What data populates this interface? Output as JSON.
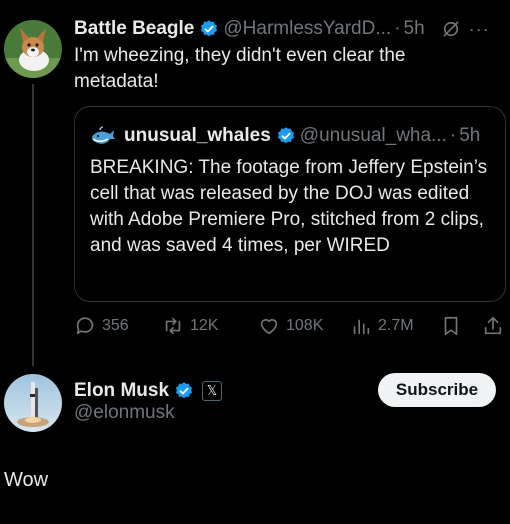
{
  "tweet": {
    "author_name": "Battle Beagle",
    "author_handle": "@HarmlessYardD...",
    "separator": "·",
    "time": "5h",
    "more_label": "···",
    "text": "I'm wheezing, they didn't even clear the metadata!"
  },
  "quote": {
    "author_name": "unusual_whales",
    "author_handle": "@unusual_wha...",
    "separator": "·",
    "time": "5h",
    "text": "BREAKING: The footage from Jeffery Epstein’s cell that was released by the DOJ was edited with Adobe Premiere Pro, stitched from 2 clips, and was saved 4 times, per WIRED"
  },
  "actions": {
    "replies": "356",
    "reposts": "12K",
    "likes": "108K",
    "views": "2.7M"
  },
  "profile": {
    "name": "Elon Musk",
    "handle": "@elonmusk",
    "affiliate_badge": "𝕏",
    "subscribe_label": "Subscribe"
  },
  "reply": {
    "text": "Wow"
  },
  "colors": {
    "background": "#000000",
    "text": "#e7e9ea",
    "muted": "#71767b",
    "verified_blue": "#1d9bf0",
    "border": "#2f3336",
    "button_bg": "#eff3f4"
  },
  "icons": {
    "verified": "verified-badge-icon",
    "grok": "grok-icon",
    "reply": "reply-icon",
    "repost": "repost-icon",
    "like": "heart-icon",
    "views": "views-icon",
    "bookmark": "bookmark-icon",
    "share": "share-icon"
  }
}
